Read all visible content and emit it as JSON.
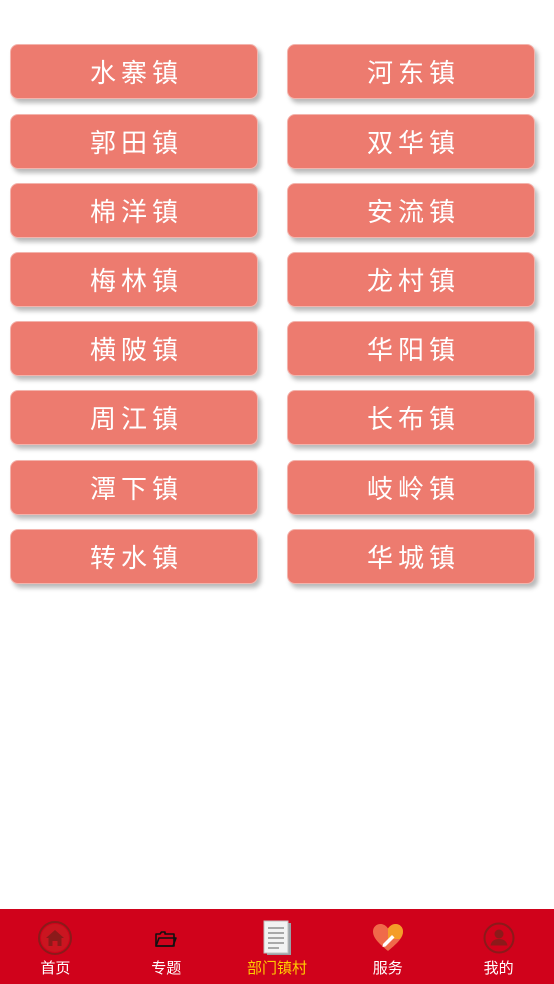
{
  "towns": [
    {
      "label": "水寨镇"
    },
    {
      "label": "河东镇"
    },
    {
      "label": "郭田镇"
    },
    {
      "label": "双华镇"
    },
    {
      "label": "棉洋镇"
    },
    {
      "label": "安流镇"
    },
    {
      "label": "梅林镇"
    },
    {
      "label": "龙村镇"
    },
    {
      "label": "横陂镇"
    },
    {
      "label": "华阳镇"
    },
    {
      "label": "周江镇"
    },
    {
      "label": "长布镇"
    },
    {
      "label": "潭下镇"
    },
    {
      "label": "岐岭镇"
    },
    {
      "label": "转水镇"
    },
    {
      "label": "华城镇"
    }
  ],
  "tabbar": {
    "tabs": [
      {
        "label": "首页",
        "icon": "home-icon",
        "active": false
      },
      {
        "label": "专题",
        "icon": "folder-icon",
        "active": false
      },
      {
        "label": "部门镇村",
        "icon": "document-icon",
        "active": true
      },
      {
        "label": "服务",
        "icon": "heart-icon",
        "active": false
      },
      {
        "label": "我的",
        "icon": "user-icon",
        "active": false
      }
    ]
  },
  "colors": {
    "button_bg": "#ed7b6f",
    "tabbar_bg": "#d0021b",
    "active_tab": "#ffcc00"
  }
}
